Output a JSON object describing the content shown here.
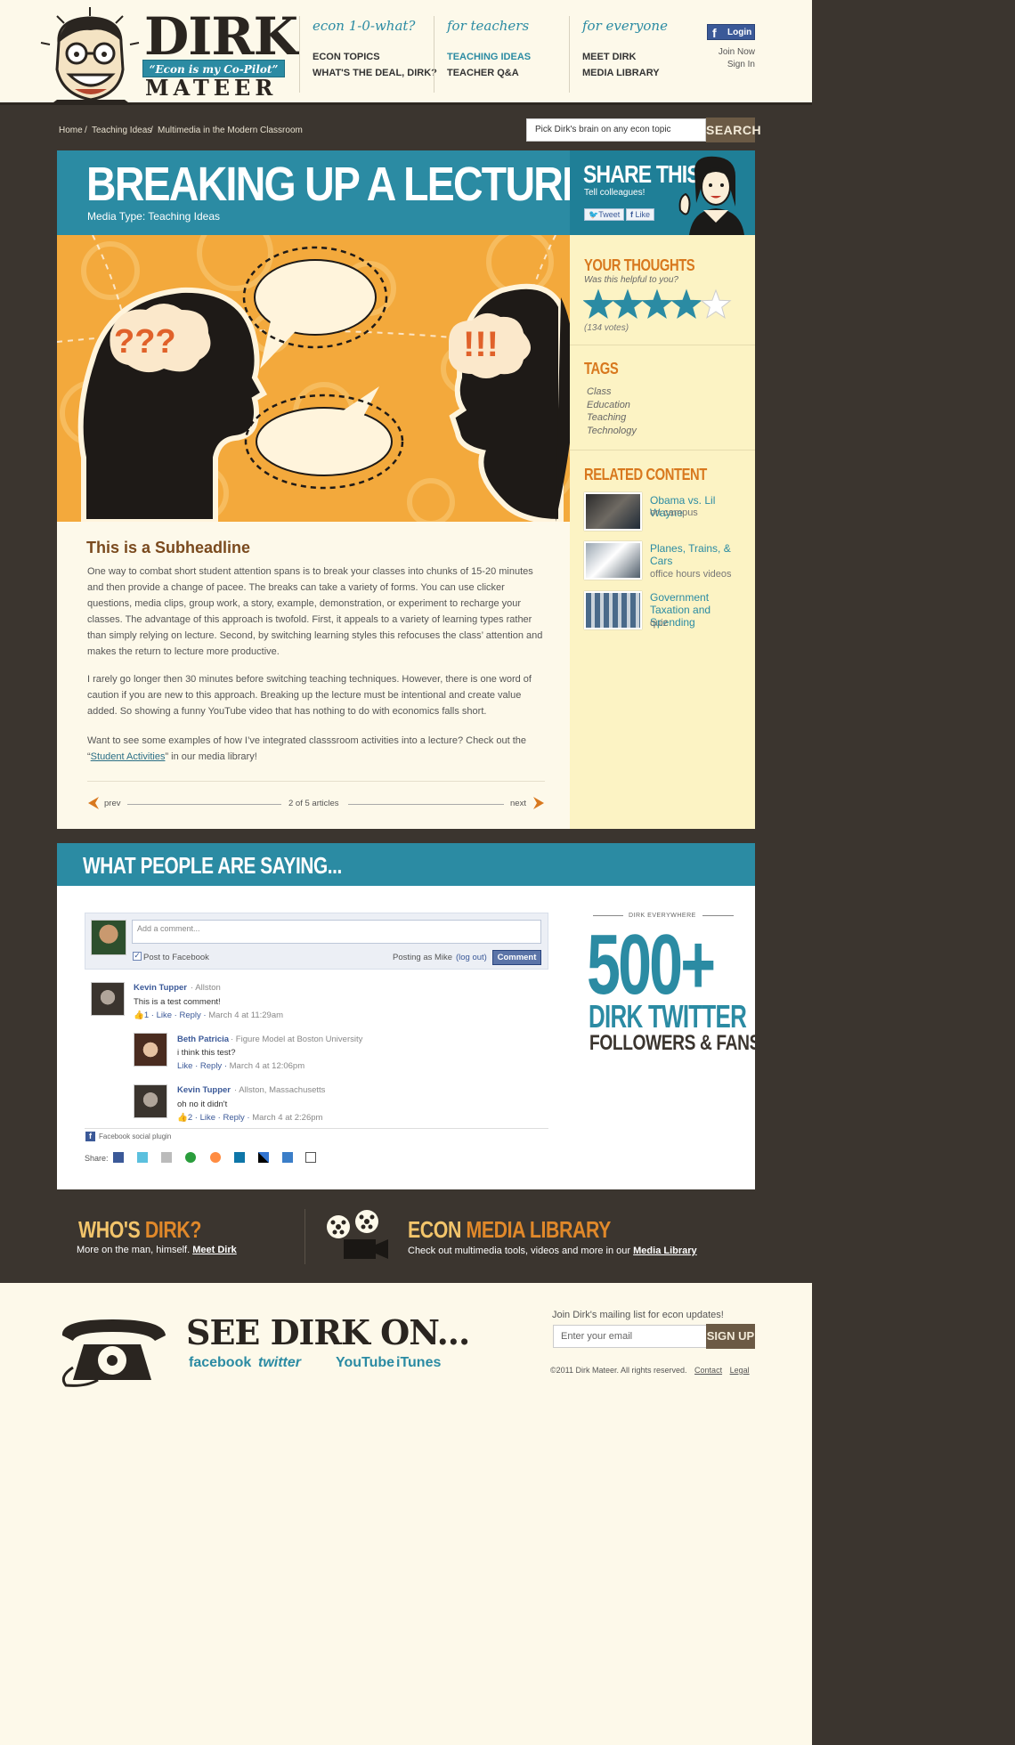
{
  "header": {
    "logo": {
      "line1": "DIRK",
      "tagline": "“Econ is my Co-Pilot”",
      "line2": "MATEER"
    },
    "nav": [
      {
        "heading": "econ 1-0-what?",
        "items": [
          "ECON TOPICS",
          "WHAT'S THE DEAL, DIRK?"
        ]
      },
      {
        "heading": "for teachers",
        "items": [
          "TEACHING IDEAS",
          "TEACHER Q&A"
        ]
      },
      {
        "heading": "for everyone",
        "items": [
          "MEET DIRK",
          "MEDIA LIBRARY"
        ]
      }
    ],
    "login": "Login",
    "join": "Join Now",
    "signin": "Sign In"
  },
  "breadcrumb": {
    "home": "Home",
    "sep": "/",
    "section": "Teaching Ideas",
    "current": "Multimedia in the Modern Classroom"
  },
  "search": {
    "placeholder": "Pick Dirk's brain on any econ topic",
    "button": "SEARCH"
  },
  "article": {
    "title": "BREAKING UP A LECTURE",
    "media_type": "Media Type: Teaching Ideas",
    "subheadline": "This is a Subheadline",
    "p1": "One way to combat short student attention spans is to break your classes into chunks of 15-20 minutes and then provide a change of pacee. The breaks can take a variety of forms. You can use clicker questions, media clips, group work, a story, example, demonstration, or experiment to recharge your classes. The advantage of this approach is twofold. First, it appeals to a variety of learning types rather than simply relying on lecture. Second, by switching learning styles this refocuses the class’ attention and makes the return to lecture more productive.",
    "p2": "I rarely go longer then 30 minutes before switching teaching techniques. However, there is one word of caution if you are new to this approach. Breaking up the lecture must be intentional and create value added. So showing a funny YouTube video that has nothing to do with economics falls short.",
    "p3_before": "Want to see some examples of how I’ve integrated classsroom activities into a lecture? Check out the “",
    "p3_link": "Student Activities",
    "p3_after": "” in our media library!",
    "prev": "prev",
    "next": "next",
    "page_count": "2 of 5 articles"
  },
  "share": {
    "title": "SHARE THIS",
    "subtitle": "Tell colleagues!",
    "tweet": "Tweet",
    "like": "Like"
  },
  "rating": {
    "title": "YOUR THOUGHTS",
    "question": "Was this helpful to you?",
    "stars": 4,
    "max": 5,
    "votes": "(134 votes)"
  },
  "tags": {
    "title": "TAGS",
    "items": [
      "Class",
      "Education",
      "Teaching",
      "Technology"
    ]
  },
  "related": {
    "title": "RELATED CONTENT",
    "items": [
      {
        "title": "Obama vs. Lil Wayne",
        "sub": "on campus"
      },
      {
        "title": "Planes, Trains, & Cars",
        "sub": "office hours videos"
      },
      {
        "title": "Government Taxation and Spending",
        "sub": "quiz"
      }
    ]
  },
  "comments": {
    "title": "WHAT PEOPLE ARE SAYING...",
    "placeholder": "Add a comment...",
    "post_to_fb": "Post to Facebook",
    "posting_as": "Posting as Mike",
    "logout": "(log out)",
    "button": "Comment",
    "list": [
      {
        "name": "Kevin Tupper",
        "meta": "· Allston",
        "text": "This is a test comment!",
        "likes": "1",
        "time": "March 4 at 11:29am"
      },
      {
        "name": "Beth Patricia",
        "meta": "· Figure Model at Boston University",
        "text": "i think this test?",
        "time": "March 4 at 12:06pm"
      },
      {
        "name": "Kevin Tupper",
        "meta": "· Allston, Massachusetts",
        "text": "oh no it didn't",
        "likes": "2",
        "time": "March 4 at 2:26pm"
      }
    ],
    "like": "Like",
    "reply": "Reply",
    "plugin": "Facebook social plugin",
    "share_label": "Share:"
  },
  "dirk_everywhere": {
    "label": "DIRK EVERYWHERE",
    "count": "500+",
    "line1": "DIRK TWITTER",
    "line2": "FOLLOWERS & FANS"
  },
  "promo": {
    "whos_a": "WHO'S",
    "whos_b": "DIRK?",
    "whos_text": "More on the man, himself.",
    "whos_link": "Meet Dirk",
    "lib_a": "ECON",
    "lib_b": "MEDIA LIBRARY",
    "lib_text": "Check out multimedia tools, videos and more in our",
    "lib_link": "Media Library"
  },
  "footer": {
    "see_dirk": "SEE DIRK ON...",
    "social": [
      "facebook",
      "twitter",
      "YouTube",
      "iTunes"
    ],
    "mailing_label": "Join Dirk's mailing list for econ updates!",
    "email_placeholder": "Enter your email",
    "signup": "SIGN UP",
    "copyright": "©2011 Dirk Mateer.  All rights reserved.",
    "contact": "Contact",
    "legal": "Legal"
  },
  "colors": {
    "teal": "#2b8ba3",
    "orange": "#d8781e",
    "dark": "#3b352f",
    "cream": "#fdf9ea",
    "sidebar": "#fcf3c4"
  }
}
